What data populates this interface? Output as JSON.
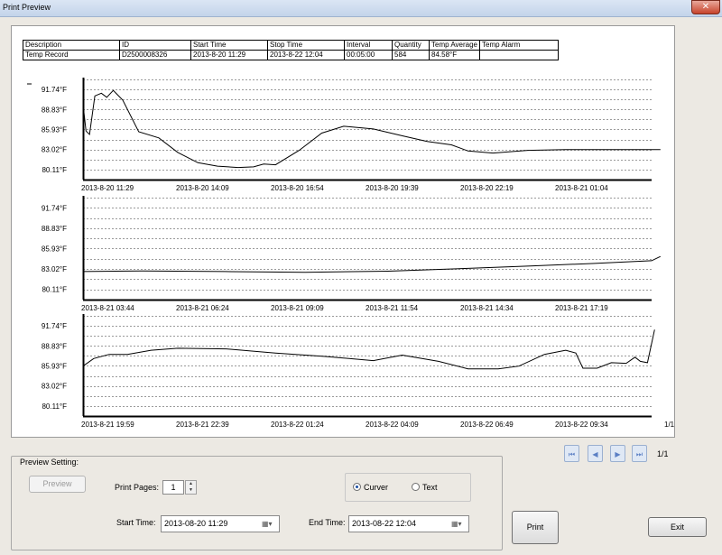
{
  "window": {
    "title": "Print Preview",
    "close_label": "✕"
  },
  "table": {
    "headers": [
      "Description",
      "ID",
      "Start Time",
      "Stop Time",
      "Interval",
      "Quantity",
      "Temp Average",
      "Temp Alarm"
    ],
    "values": [
      "Temp Record",
      "D2500008326",
      "2013-8-20 11:29",
      "2013-8-22 12:04",
      "00:05:00",
      "584",
      "84.58°F",
      ""
    ]
  },
  "chart_data": [
    {
      "type": "line",
      "y_tick_labels": [
        "91.74°F",
        "88.83°F",
        "85.93°F",
        "83.02°F",
        "80.11°F"
      ],
      "ylim": [
        78.65,
        93.2
      ],
      "x_tick_labels": [
        "2013-8-20 11:29",
        "2013-8-20 14:09",
        "2013-8-20 16:54",
        "2013-8-20 19:39",
        "2013-8-20 22:19",
        "2013-8-21 01:04"
      ],
      "x": [
        "2013-8-20 11:29",
        "2013-8-20 11:34",
        "2013-8-20 11:40",
        "2013-8-20 11:49",
        "2013-8-20 12:00",
        "2013-8-20 12:09",
        "2013-8-20 12:20",
        "2013-8-20 12:36",
        "2013-8-20 13:03",
        "2013-8-20 13:37",
        "2013-8-20 14:09",
        "2013-8-20 14:43",
        "2013-8-20 15:16",
        "2013-8-20 15:51",
        "2013-8-20 16:17",
        "2013-8-20 16:34",
        "2013-8-20 16:54",
        "2013-8-20 17:34",
        "2013-8-20 18:12",
        "2013-8-20 18:49",
        "2013-8-20 19:39",
        "2013-8-20 20:29",
        "2013-8-20 21:10",
        "2013-8-20 21:51",
        "2013-8-20 22:19",
        "2013-8-20 23:01",
        "2013-8-21 00:00",
        "2013-8-21 01:04",
        "2013-8-21 02:03",
        "2013-8-21 03:44"
      ],
      "y": [
        89.6,
        85.7,
        85.2,
        90.8,
        91.2,
        90.6,
        91.6,
        90.2,
        85.6,
        84.7,
        82.6,
        81.1,
        80.6,
        80.4,
        80.5,
        80.9,
        80.8,
        82.9,
        85.4,
        86.4,
        86.0,
        85.0,
        84.2,
        83.7,
        82.8,
        82.5,
        82.9,
        83.0,
        83.0,
        83.0
      ]
    },
    {
      "type": "line",
      "y_tick_labels": [
        "91.74°F",
        "88.83°F",
        "85.93°F",
        "83.02°F",
        "80.11°F"
      ],
      "ylim": [
        78.65,
        93.2
      ],
      "x_tick_labels": [
        "2013-8-21 03:44",
        "2013-8-21 06:24",
        "2013-8-21 09:09",
        "2013-8-21 11:54",
        "2013-8-21 14:34",
        "2013-8-21 17:19"
      ],
      "x": [
        "2013-8-21 03:44",
        "2013-8-21 05:24",
        "2013-8-21 07:44",
        "2013-8-21 09:59",
        "2013-8-21 12:19",
        "2013-8-21 14:34",
        "2013-8-21 16:19",
        "2013-8-21 18:04",
        "2013-8-21 19:44",
        "2013-8-21 19:59"
      ],
      "y": [
        82.65,
        82.75,
        82.65,
        82.55,
        82.7,
        83.1,
        83.45,
        83.8,
        84.2,
        84.8
      ]
    },
    {
      "type": "line",
      "y_tick_labels": [
        "91.74°F",
        "88.83°F",
        "85.93°F",
        "83.02°F",
        "80.11°F"
      ],
      "ylim": [
        78.65,
        93.2
      ],
      "x_tick_labels": [
        "2013-8-21 19:59",
        "2013-8-21 22:39",
        "2013-8-22 01:24",
        "2013-8-22 04:09",
        "2013-8-22 06:49",
        "2013-8-22 09:34"
      ],
      "x": [
        "2013-8-21 19:59",
        "2013-8-21 20:17",
        "2013-8-21 20:43",
        "2013-8-21 21:14",
        "2013-8-21 21:54",
        "2013-8-21 22:39",
        "2013-8-22 00:01",
        "2013-8-22 01:24",
        "2013-8-22 02:48",
        "2013-8-22 04:09",
        "2013-8-22 04:58",
        "2013-8-22 05:59",
        "2013-8-22 06:49",
        "2013-8-22 07:40",
        "2013-8-22 08:15",
        "2013-8-22 08:58",
        "2013-8-22 09:34",
        "2013-8-22 09:51",
        "2013-8-22 10:03",
        "2013-8-22 10:27",
        "2013-8-22 10:51",
        "2013-8-22 11:16",
        "2013-8-22 11:31",
        "2013-8-22 11:40",
        "2013-8-22 11:52",
        "2013-8-22 12:04"
      ],
      "y": [
        85.9,
        87.0,
        87.6,
        87.6,
        88.2,
        88.5,
        88.4,
        87.8,
        87.3,
        86.7,
        87.5,
        86.6,
        85.5,
        85.5,
        85.9,
        87.6,
        88.2,
        87.8,
        85.6,
        85.6,
        86.4,
        86.3,
        87.2,
        86.6,
        86.4,
        91.2
      ]
    }
  ],
  "page_indicator": "1/1",
  "nav": {
    "first": "⏮",
    "prev": "◀",
    "next": "▶",
    "last": "⏭",
    "page": "1/1"
  },
  "preview": {
    "group_title": "Preview Setting:",
    "preview_button": "Preview",
    "print_pages_label": "Print Pages:",
    "print_pages_value": "1",
    "curve_label": "Curver",
    "text_label": "Text",
    "start_time_label": "Start Time:",
    "start_time_value": "2013-08-20 11:29",
    "end_time_label": "End Time:",
    "end_time_value": "2013-08-22 12:04",
    "calendar_icon": "▦▾"
  },
  "buttons": {
    "print": "Print",
    "exit": "Exit"
  }
}
